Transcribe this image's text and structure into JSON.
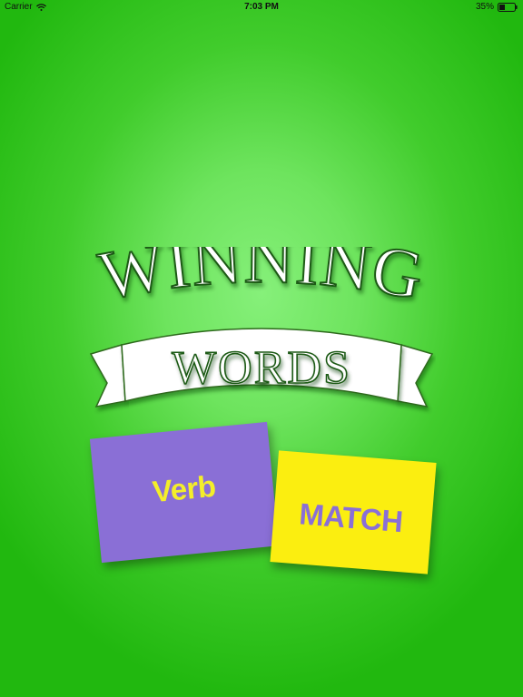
{
  "status_bar": {
    "carrier": "Carrier",
    "time": "7:03 PM",
    "battery": "35%"
  },
  "logo": {
    "line1": "WINNING",
    "line2": "WORDS"
  },
  "cards": {
    "verb_label": "Verb",
    "match_label": "MATCH"
  },
  "colors": {
    "background_center": "#86f07a",
    "background_edge": "#21b80f",
    "verb_card": "#8a6fd6",
    "verb_text": "#f4ee2a",
    "match_card": "#fbee10",
    "match_text": "#8a6fd6"
  },
  "icons": [
    "wifi-icon",
    "battery-icon"
  ]
}
